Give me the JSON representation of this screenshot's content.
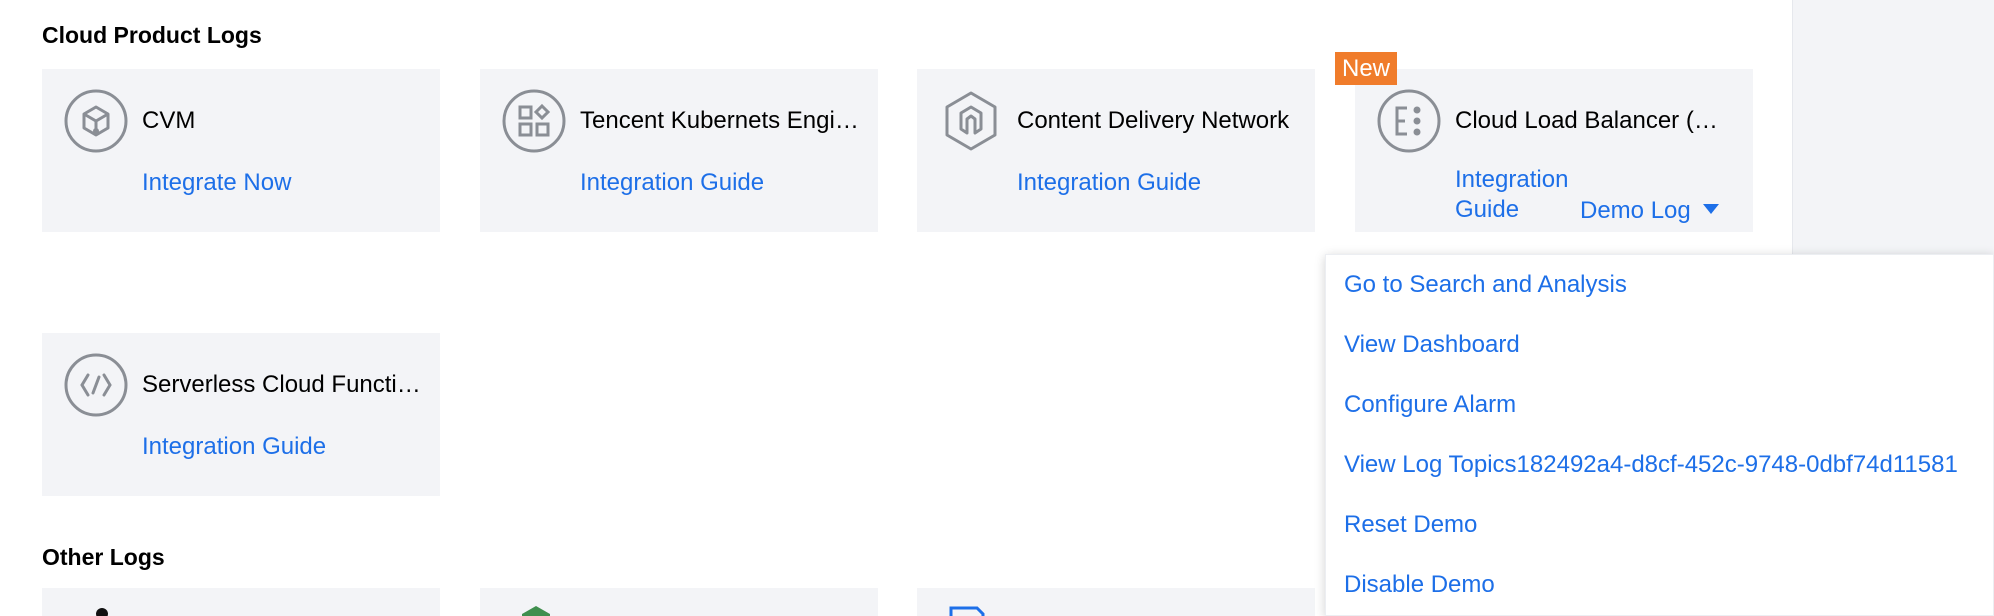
{
  "sections": {
    "cloud_product_logs": "Cloud Product Logs",
    "other_logs": "Other Logs"
  },
  "cards": [
    {
      "name": "CVM",
      "link": "Integrate Now",
      "icon": "cvm-box-icon"
    },
    {
      "name": "Tencent Kubernets Engine",
      "link": "Integration Guide",
      "icon": "grid-apps-icon"
    },
    {
      "name": "Content Delivery Network",
      "link": "Integration Guide",
      "icon": "hexagon-cdn-icon"
    },
    {
      "name": "Cloud Load Balancer (CLB)",
      "link": "Integration Guide",
      "icon": "load-balancer-icon",
      "badge": "New",
      "demo": "Demo Log"
    },
    {
      "name": "Serverless Cloud Function",
      "link": "Integration Guide",
      "icon": "code-function-icon"
    }
  ],
  "dropdown": {
    "items": [
      "Go to Search and Analysis",
      "View Dashboard",
      "Configure Alarm",
      "View Log Topics182492a4-d8cf-452c-9748-0dbf74d11581",
      "Reset Demo",
      "Disable Demo"
    ]
  },
  "colors": {
    "link": "#1d6fe8",
    "badge": "#f07c2b",
    "card_bg": "#f3f4f7",
    "icon_gray": "#8a8e95"
  }
}
